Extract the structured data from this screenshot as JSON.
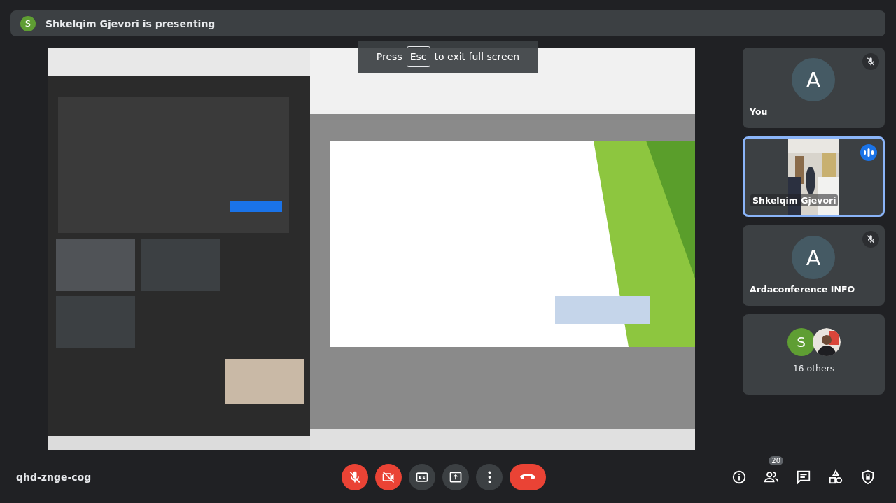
{
  "presenter_banner": {
    "avatar_letter": "S",
    "text": "Shkelqim Gjevori is presenting"
  },
  "fullscreen_hint": {
    "before": "Press",
    "key": "Esc",
    "after": "to exit full screen"
  },
  "tiles": [
    {
      "kind": "avatar",
      "letter": "A",
      "name": "You",
      "muted": true,
      "speaking": false,
      "selected": false
    },
    {
      "kind": "video",
      "name": "Shkelqim Gjevori",
      "muted": false,
      "speaking": true,
      "selected": true
    },
    {
      "kind": "avatar",
      "letter": "A",
      "name": "Ardaconference INFO",
      "muted": true,
      "speaking": false,
      "selected": false
    },
    {
      "kind": "others",
      "letter": "S",
      "name": "16 others",
      "muted": false,
      "speaking": false,
      "selected": false
    }
  ],
  "meeting_code": "qhd-znge-cog",
  "controls": [
    {
      "kind": "mic",
      "off": true
    },
    {
      "kind": "camera",
      "off": true
    },
    {
      "kind": "captions"
    },
    {
      "kind": "present"
    },
    {
      "kind": "more"
    },
    {
      "kind": "leave"
    }
  ],
  "side_actions": [
    {
      "kind": "info"
    },
    {
      "kind": "people",
      "badge": "20"
    },
    {
      "kind": "chat"
    },
    {
      "kind": "activities"
    },
    {
      "kind": "safety"
    }
  ]
}
